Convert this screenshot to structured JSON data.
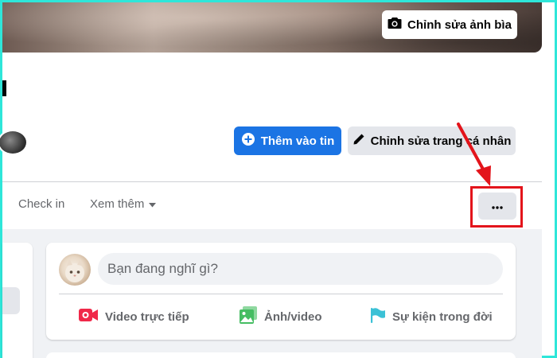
{
  "cover": {
    "edit_button_label": "Chỉnh sửa ảnh bìa"
  },
  "profile": {
    "add_story_label": "Thêm vào tin",
    "edit_profile_label": "Chỉnh sửa trang cá nhân"
  },
  "tabs": {
    "checkin_label": "Check in",
    "see_more_label": "Xem thêm",
    "more_options_label": "•••"
  },
  "composer": {
    "placeholder": "Bạn đang nghĩ gì?",
    "actions": {
      "live_label": "Video trực tiếp",
      "photo_label": "Ảnh/video",
      "event_label": "Sự kiện trong đời"
    }
  },
  "colors": {
    "primary": "#1b74e4",
    "secondary_button": "#e4e6eb",
    "annotation_red": "#e3141b",
    "frame": "#2ee6d9",
    "live_icon": "#f02849",
    "photo_icon": "#45bd62",
    "event_icon": "#3bc1d6"
  },
  "icons": {
    "camera": "camera-icon",
    "plus": "plus-circle-icon",
    "pencil": "pencil-icon",
    "caret": "caret-down-icon",
    "live": "live-video-icon",
    "photo": "photo-video-icon",
    "flag": "flag-icon"
  }
}
